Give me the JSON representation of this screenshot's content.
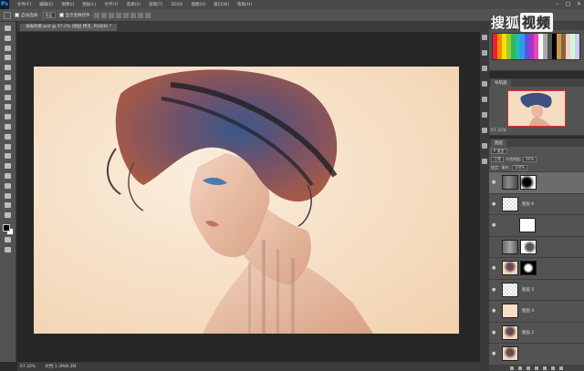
{
  "menubar": {
    "logo": "Ps",
    "items": [
      "文件(F)",
      "编辑(E)",
      "图像(I)",
      "图层(L)",
      "文字(Y)",
      "选择(S)",
      "滤镜(T)",
      "3D(D)",
      "视图(V)",
      "窗口(W)",
      "帮助(H)"
    ]
  },
  "options": {
    "auto_select_label": "自动选择:",
    "auto_select_value": "图层",
    "show_transform_label": "显示变换控件"
  },
  "document": {
    "tab_title": "海报效果.psd @ 67.2% (图层 拷贝, RGB/8) *",
    "status_zoom": "67.32%",
    "status_doc": "文档:1.3M/8.3M"
  },
  "watermark": {
    "text": "搜狐",
    "sub": "视频"
  },
  "panels": {
    "swatches_tab": "色板",
    "navigator_tab": "导航器",
    "navigator_zoom": "67.32%",
    "layers_tab": "图层",
    "kind_label": "P 类型",
    "blend_mode": "正常",
    "opacity_label": "不透明度:",
    "opacity_value": "60%",
    "lock_label": "锁定:",
    "fill_label": "填充:",
    "fill_value": "100%"
  },
  "layers": [
    {
      "name": "",
      "thumb": "forest",
      "mask": "dark-mask",
      "active": true
    },
    {
      "name": "图层 6",
      "thumb": "checker",
      "mask": "",
      "active": false
    },
    {
      "name": "",
      "thumb": "",
      "mask": "white",
      "active": false
    },
    {
      "name": "",
      "thumb": "forest",
      "mask": "light-mask",
      "active": false
    },
    {
      "name": "",
      "thumb": "portrait",
      "mask": "black-mask",
      "active": false
    },
    {
      "name": "图层 5",
      "thumb": "checker",
      "mask": "",
      "active": false
    },
    {
      "name": "图层 4",
      "thumb": "cream",
      "mask": "",
      "active": false
    },
    {
      "name": "图层 2",
      "thumb": "portrait",
      "mask": "",
      "active": false
    },
    {
      "name": "",
      "thumb": "portrait",
      "mask": "",
      "active": false
    }
  ],
  "colors": {
    "canvas_bg": "#f7dec4",
    "hair_blue": "#3d5d8f",
    "hair_red": "#b5523b"
  }
}
